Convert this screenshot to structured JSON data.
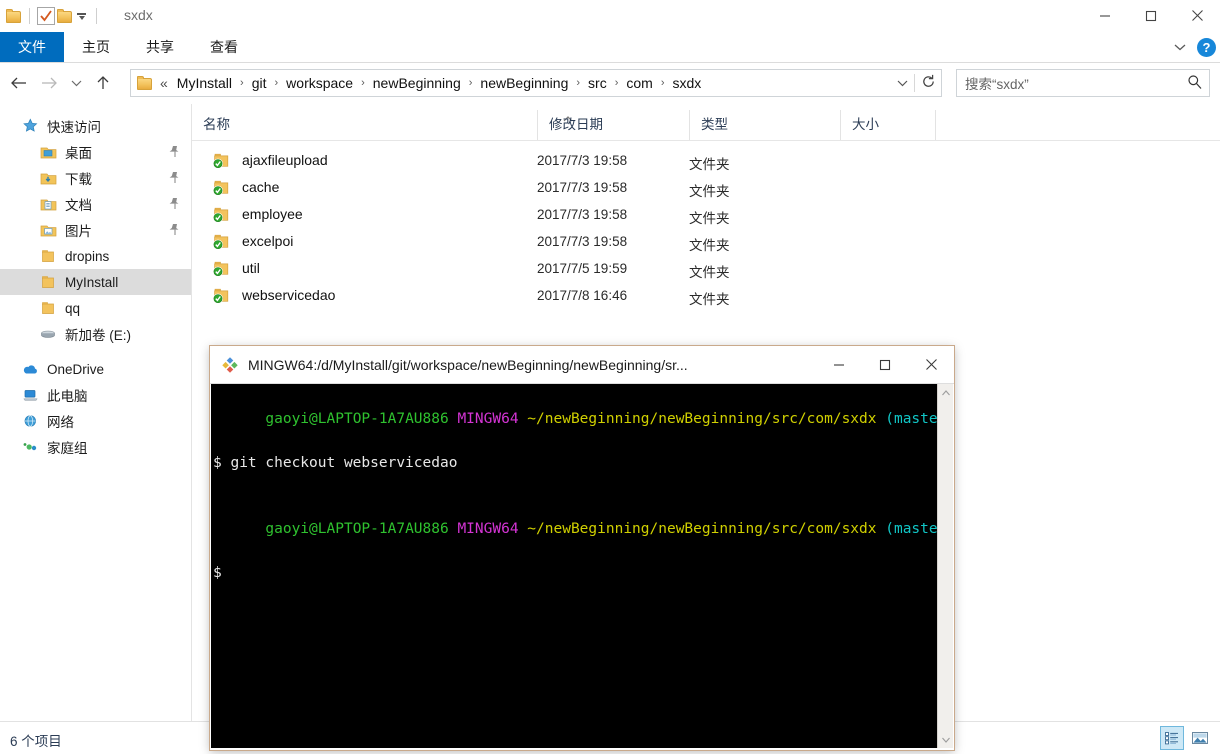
{
  "explorer": {
    "window_title": "sxdx",
    "quick_access_toolbar": {
      "folder_label": "folder-icon",
      "properties_label": "properties-icon",
      "new_folder_label": "new-folder-icon",
      "customize_label": "customize-dropdown"
    },
    "window_controls": {
      "minimize": "—",
      "maximize": "□",
      "close": "✕"
    },
    "ribbon": {
      "tabs": [
        {
          "label": "文件",
          "active": true
        },
        {
          "label": "主页",
          "active": false
        },
        {
          "label": "共享",
          "active": false
        },
        {
          "label": "查看",
          "active": false
        }
      ],
      "collapse_label": "collapse-ribbon",
      "help_label": "?"
    },
    "address": {
      "back_label": "←",
      "forward_label": "→",
      "recent_label": "recent-locations",
      "up_label": "↑",
      "overflow": "«",
      "separator": "›",
      "crumbs": [
        "MyInstall",
        "git",
        "workspace",
        "newBeginning",
        "newBeginning",
        "src",
        "com",
        "sxdx"
      ],
      "dropdown_label": "address-dropdown",
      "refresh_label": "refresh"
    },
    "search": {
      "placeholder": "搜索“sxdx”",
      "icon": "search-icon"
    },
    "navpane": {
      "items": [
        {
          "label": "快速访问",
          "level": 0,
          "icon": "star-icon",
          "pinned": false,
          "selected": false
        },
        {
          "label": "桌面",
          "level": 1,
          "icon": "desktop-icon",
          "pinned": true,
          "selected": false
        },
        {
          "label": "下载",
          "level": 1,
          "icon": "download-icon",
          "pinned": true,
          "selected": false
        },
        {
          "label": "文档",
          "level": 1,
          "icon": "documents-icon",
          "pinned": true,
          "selected": false
        },
        {
          "label": "图片",
          "level": 1,
          "icon": "pictures-icon",
          "pinned": true,
          "selected": false
        },
        {
          "label": "dropins",
          "level": 1,
          "icon": "folder-icon",
          "pinned": false,
          "selected": false
        },
        {
          "label": "MyInstall",
          "level": 1,
          "icon": "folder-icon",
          "pinned": false,
          "selected": true
        },
        {
          "label": "qq",
          "level": 1,
          "icon": "folder-icon",
          "pinned": false,
          "selected": false
        },
        {
          "label": "新加卷 (E:)",
          "level": 1,
          "icon": "drive-icon",
          "pinned": false,
          "selected": false
        },
        {
          "label": "OneDrive",
          "level": 0,
          "icon": "cloud-icon",
          "pinned": false,
          "selected": false
        },
        {
          "label": "此电脑",
          "level": 0,
          "icon": "computer-icon",
          "pinned": false,
          "selected": false
        },
        {
          "label": "网络",
          "level": 0,
          "icon": "network-icon",
          "pinned": false,
          "selected": false
        },
        {
          "label": "家庭组",
          "level": 0,
          "icon": "homegroup-icon",
          "pinned": false,
          "selected": false
        }
      ]
    },
    "filelist": {
      "columns": [
        {
          "label": "名称",
          "sorted": "asc"
        },
        {
          "label": "修改日期",
          "sorted": ""
        },
        {
          "label": "类型",
          "sorted": ""
        },
        {
          "label": "大小",
          "sorted": ""
        }
      ],
      "rows": [
        {
          "name": "ajaxfileupload",
          "date": "2017/7/3 19:58",
          "type": "文件夹",
          "size": ""
        },
        {
          "name": "cache",
          "date": "2017/7/3 19:58",
          "type": "文件夹",
          "size": ""
        },
        {
          "name": "employee",
          "date": "2017/7/3 19:58",
          "type": "文件夹",
          "size": ""
        },
        {
          "name": "excelpoi",
          "date": "2017/7/3 19:58",
          "type": "文件夹",
          "size": ""
        },
        {
          "name": "util",
          "date": "2017/7/5 19:59",
          "type": "文件夹",
          "size": ""
        },
        {
          "name": "webservicedao",
          "date": "2017/7/8 16:46",
          "type": "文件夹",
          "size": ""
        }
      ]
    },
    "statusbar": {
      "item_count": "6 个项目",
      "details_view_label": "details-view",
      "large_icons_view_label": "large-icons-view"
    }
  },
  "terminal": {
    "title": "MINGW64:/d/MyInstall/git/workspace/newBeginning/newBeginning/sr...",
    "icon": "git-bash-icon",
    "controls": {
      "minimize": "—",
      "maximize": "□",
      "close": "✕"
    },
    "lines": [
      {
        "segments": [
          {
            "text": "gaoyi@LAPTOP-1A7AU886",
            "color": "green"
          },
          {
            "text": " ",
            "color": "white"
          },
          {
            "text": "MINGW64",
            "color": "magenta"
          },
          {
            "text": " ",
            "color": "white"
          },
          {
            "text": "~/newBeginning/newBeginning/src/com/sxdx",
            "color": "yellow"
          },
          {
            "text": " ",
            "color": "white"
          },
          {
            "text": "(master)",
            "color": "cyan"
          }
        ]
      },
      {
        "segments": [
          {
            "text": "$ git checkout webservicedao",
            "color": "white"
          }
        ]
      },
      {
        "segments": [
          {
            "text": "",
            "color": "white"
          }
        ]
      },
      {
        "segments": [
          {
            "text": "gaoyi@LAPTOP-1A7AU886",
            "color": "green"
          },
          {
            "text": " ",
            "color": "white"
          },
          {
            "text": "MINGW64",
            "color": "magenta"
          },
          {
            "text": " ",
            "color": "white"
          },
          {
            "text": "~/newBeginning/newBeginning/src/com/sxdx",
            "color": "yellow"
          },
          {
            "text": " ",
            "color": "white"
          },
          {
            "text": "(master)",
            "color": "cyan"
          }
        ]
      },
      {
        "segments": [
          {
            "text": "$",
            "color": "white"
          }
        ]
      }
    ],
    "scrollbar": {
      "up": "∧",
      "down": "∨"
    }
  },
  "colors": {
    "accent_blue": "#006cbe",
    "selection_gray": "#dcdcdc",
    "terminal_bg": "#000000",
    "term_green": "#2fc22f",
    "term_magenta": "#d434d4",
    "term_yellow": "#d0d000",
    "term_cyan": "#11c6c6",
    "folder_yellow": "#f3c35d",
    "git_check_green": "#2fa82f"
  }
}
